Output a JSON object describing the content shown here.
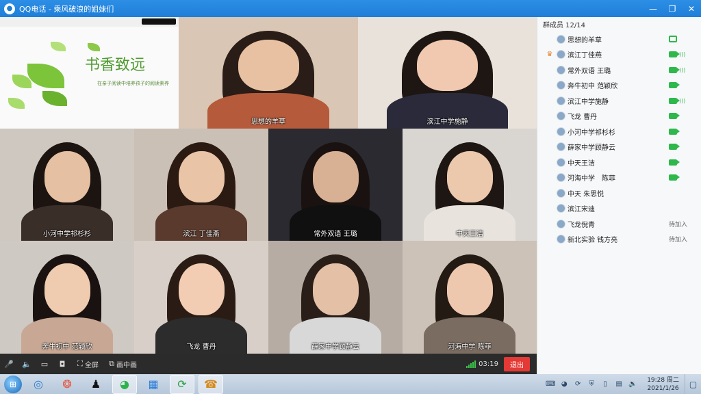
{
  "window": {
    "app": "QQ电话",
    "separator": "-",
    "group_name": "乘风破浪的姐妹们",
    "buttons": [
      "min",
      "max",
      "close"
    ]
  },
  "slide": {
    "title": "书香致远",
    "subtitle": "在亲子阅读中培养孩子的阅读素养"
  },
  "tiles": [
    {
      "name": "思想的羊草",
      "bg": "#d9c6b4",
      "skin": "#e8c1a3",
      "hair": "#2a1c16",
      "body": "#b55a3a"
    },
    {
      "name": "滨江中学施静",
      "bg": "#e9e2da",
      "skin": "#f0c9b0",
      "hair": "#1e1613",
      "body": "#2a2a3a"
    },
    {
      "name": "小河中学祁杉杉",
      "bg": "#cfc8c0",
      "skin": "#e6c0a2",
      "hair": "#1c1410",
      "body": "#3a2e28"
    },
    {
      "name": "滨江 丁佳燕",
      "bg": "#cbc0b6",
      "skin": "#e9c4a6",
      "hair": "#2a1a12",
      "body": "#5a3a2c"
    },
    {
      "name": "常外双语 王璐",
      "bg": "#2a2a30",
      "skin": "#d8b094",
      "hair": "#1a1210",
      "body": "#101010"
    },
    {
      "name": "中天王洁",
      "bg": "#d9d6d2",
      "skin": "#ecc8ac",
      "hair": "#1e1612",
      "body": "#e8e3dc"
    },
    {
      "name": "奔牛初中 范颖欣",
      "bg": "#cfc9c3",
      "skin": "#efcbb0",
      "hair": "#1a1210",
      "body": "#c8a894"
    },
    {
      "name": "飞龙 曹丹",
      "bg": "#d8cfc8",
      "skin": "#f2cdb4",
      "hair": "#2a1c14",
      "body": "#2c2c2c"
    },
    {
      "name": "薛家中学顾静云",
      "bg": "#b6aca4",
      "skin": "#e4c0a6",
      "hair": "#2a1e18",
      "body": "#d8d8d8"
    },
    {
      "name": "河海中学 陈菲",
      "bg": "#cdc2b8",
      "skin": "#eec8ae",
      "hair": "#231a14",
      "body": "#7a6c60"
    }
  ],
  "toolbar": {
    "fullscreen_label": "全屏",
    "pip_label": "画中画",
    "signal_bars": 5,
    "duration": "03:19",
    "leave_label": "退出",
    "status_color": "#3cc44a",
    "leave_color": "#e53935"
  },
  "members": {
    "header": "群成员 12/14",
    "items": [
      {
        "name": "思想的羊草",
        "status": "screen",
        "host": false
      },
      {
        "name": "滨江丁佳燕",
        "status": "cam-speaking",
        "host": true
      },
      {
        "name": "常外双语 王璐",
        "status": "cam-speaking",
        "host": false
      },
      {
        "name": "奔牛初中 范颖欣",
        "status": "cam",
        "host": false
      },
      {
        "name": "滨江中学施静",
        "status": "cam-speaking",
        "host": false
      },
      {
        "name": "飞龙 曹丹",
        "status": "cam",
        "host": false
      },
      {
        "name": "小河中学祁杉杉",
        "status": "cam",
        "host": false
      },
      {
        "name": "薛家中学顾静云",
        "status": "cam",
        "host": false
      },
      {
        "name": "中天王洁",
        "status": "cam",
        "host": false
      },
      {
        "name": "河海中学　陈菲",
        "status": "cam",
        "host": false
      },
      {
        "name": "中天 朱思悦",
        "status": "none",
        "host": false
      },
      {
        "name": "滨江宋迪",
        "status": "none",
        "host": false
      },
      {
        "name": "飞龙倪青",
        "status": "pending",
        "host": false
      },
      {
        "name": "新北实验 钱方亮",
        "status": "pending",
        "host": false
      }
    ],
    "pending_label": "待加入"
  },
  "taskbar": {
    "apps": [
      "search-app-icon",
      "browser-icon",
      "qq-icon",
      "wechat-icon",
      "tiles-app-icon",
      "sync-app-icon",
      "qq-call-icon"
    ],
    "time": "19:28 周二",
    "date": "2021/1/26"
  }
}
